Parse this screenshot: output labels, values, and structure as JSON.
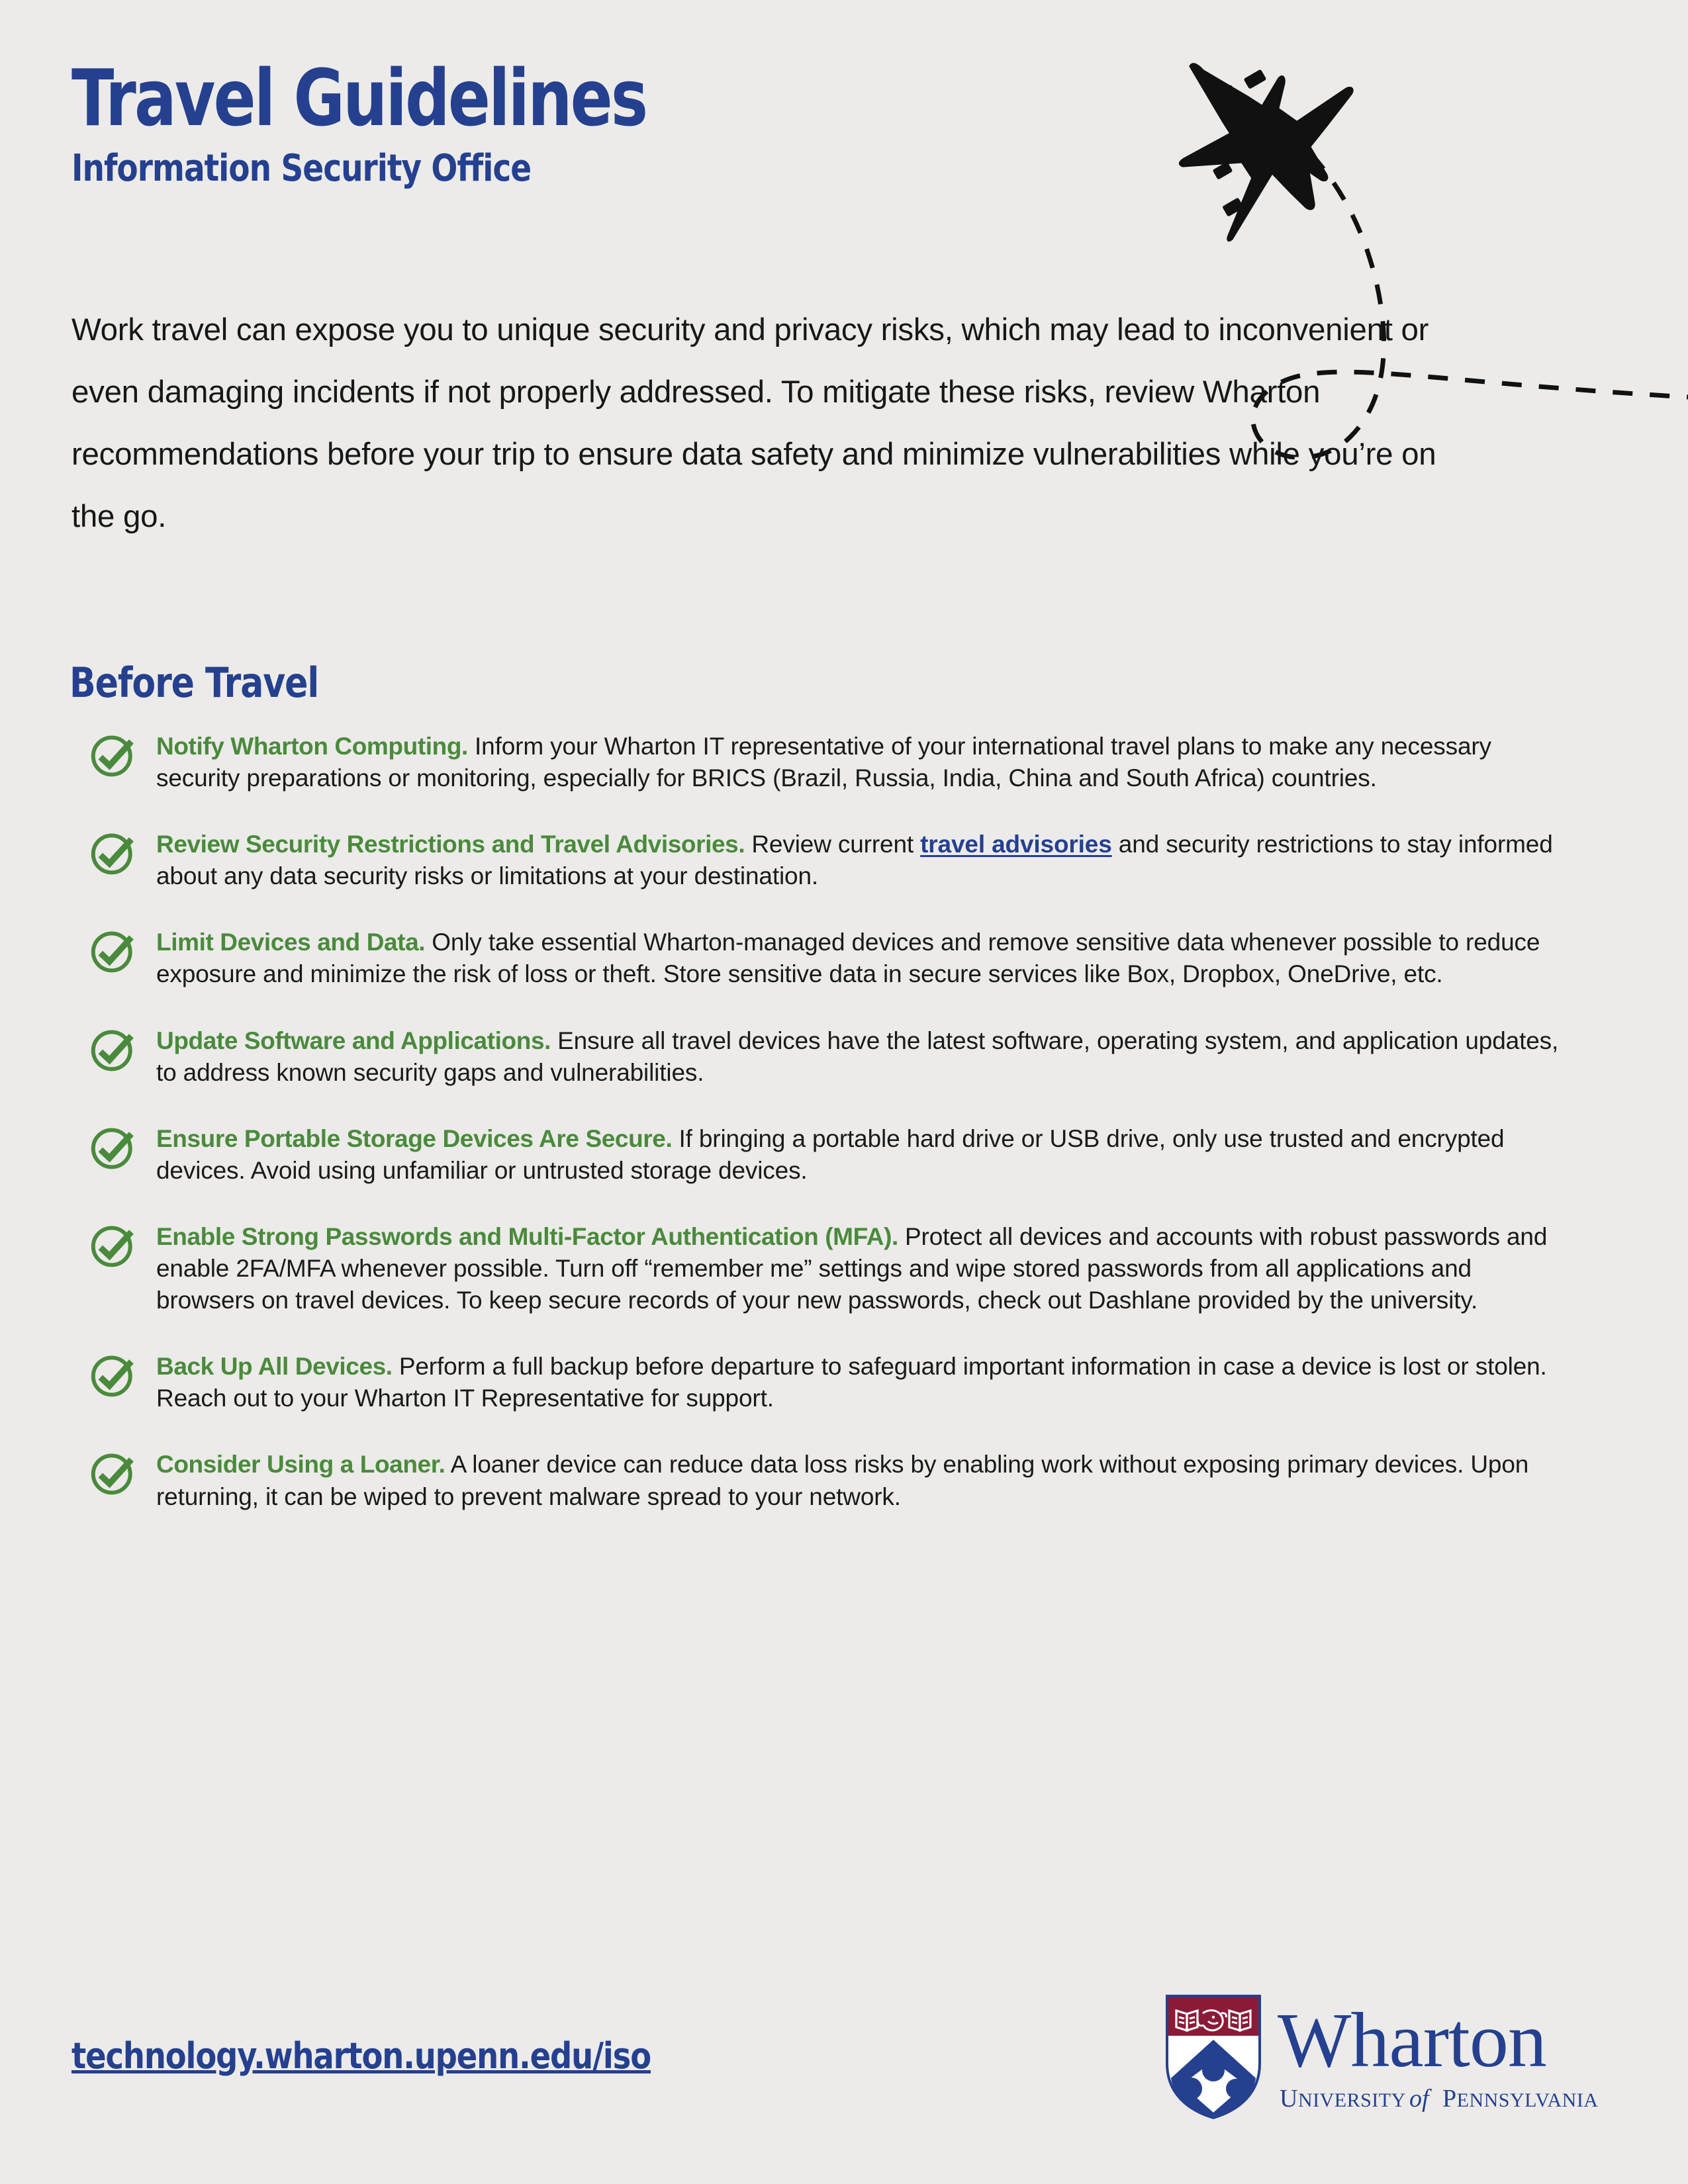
{
  "page": {
    "background_color": "#ecebe9",
    "brand_navy": "#25408f",
    "brand_green": "#4a8a3c",
    "body_text_color": "#1a1a1a"
  },
  "header": {
    "title": "Travel Guidelines",
    "subtitle": "Information Security Office",
    "plane_icon": "airplane-icon",
    "trail_icon": "dashed-flight-path"
  },
  "intro": {
    "paragraph": "Work travel can expose you to unique security and privacy risks, which may lead to inconvenient or even damaging incidents if not properly addressed. To mitigate these risks, review Wharton recommendations before your trip to ensure data safety and minimize vulnerabilities while you’re on the go."
  },
  "section": {
    "heading": "Before Travel"
  },
  "checklist": {
    "check_icon": "check-circle-icon",
    "items": [
      {
        "lead": "Notify Wharton Computing.",
        "body": " Inform your Wharton IT representative of your international travel plans to make any necessary security preparations or monitoring, especially for BRICS (Brazil, Russia, India, China and South Africa) countries."
      },
      {
        "lead": "Review Security Restrictions and Travel Advisories.",
        "body_before_link": " Review current ",
        "link_text": "travel advisories",
        "body_after_link": " and security restrictions to stay informed about any data security risks or limitations at your destination."
      },
      {
        "lead": "Limit Devices and Data.",
        "body": " Only take essential Wharton-managed devices and remove sensitive data whenever possible to reduce exposure and minimize the risk of loss or theft. Store sensitive data in secure services like Box, Dropbox, OneDrive, etc."
      },
      {
        "lead": "Update Software and Applications.",
        "body": " Ensure all travel devices have the latest software, operating system, and application updates, to address known security gaps and vulnerabilities."
      },
      {
        "lead": "Ensure Portable Storage Devices Are Secure.",
        "body": " If bringing a portable hard drive or USB drive, only use trusted and encrypted devices. Avoid using unfamiliar or untrusted storage devices."
      },
      {
        "lead": "Enable Strong Passwords and Multi-Factor Authentication (MFA).",
        "body": " Protect all devices and accounts with robust passwords and enable 2FA/MFA whenever possible. Turn off “remember me” settings and wipe stored passwords from all applications and browsers on travel devices. To keep secure records of your new passwords, check out Dashlane provided by the university."
      },
      {
        "lead": "Back Up All Devices.",
        "body": " Perform a full backup before departure to safeguard important information in case a device is lost or stolen. Reach out to your Wharton IT Representative for support."
      },
      {
        "lead": "Consider Using a Loaner.",
        "body": " A loaner device can reduce data loss risks by enabling work without exposing primary devices. Upon returning, it can be wiped to prevent malware spread to your network."
      }
    ]
  },
  "footer": {
    "url": "technology.wharton.upenn.edu/iso",
    "logo": {
      "icon": "wharton-shield-icon",
      "wordmark": "Wharton",
      "tagline_part1": "University",
      "tagline_part2": "of",
      "tagline_part3": "Pennsylvania",
      "shield_maroon": "#8b1a37",
      "shield_navy": "#25408f"
    }
  }
}
